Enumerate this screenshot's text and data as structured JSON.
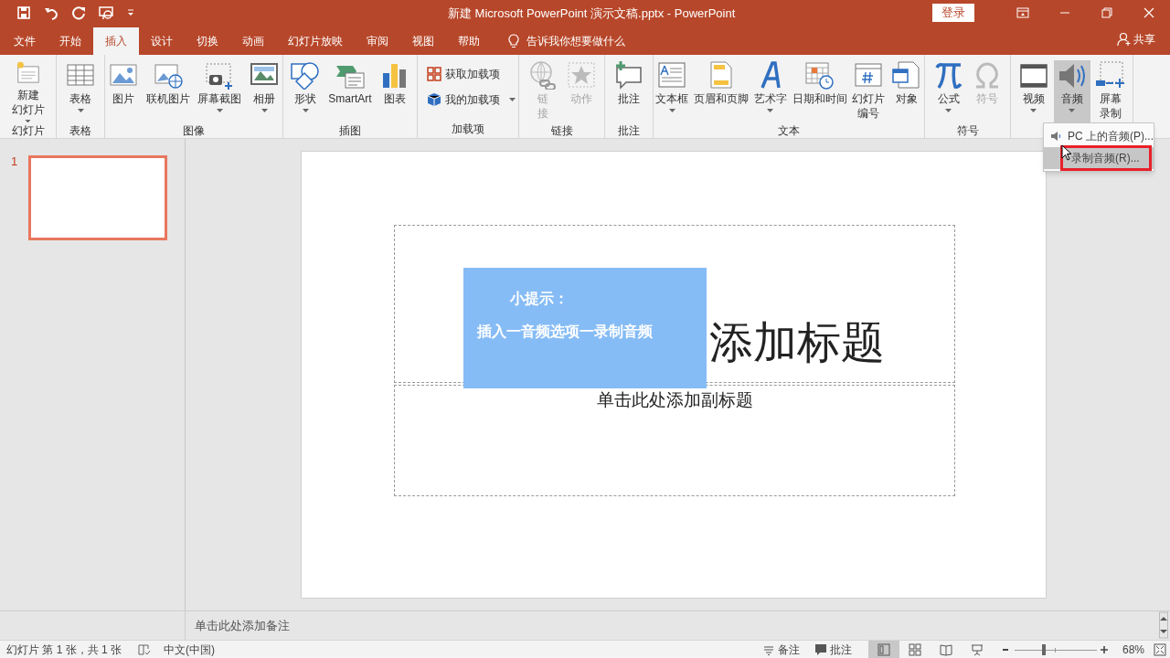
{
  "window": {
    "title": "新建 Microsoft PowerPoint 演示文稿.pptx  -  PowerPoint",
    "sign_in": "登录"
  },
  "tabs": [
    {
      "label": "文件",
      "selected": false
    },
    {
      "label": "开始",
      "selected": false
    },
    {
      "label": "插入",
      "selected": true
    },
    {
      "label": "设计",
      "selected": false
    },
    {
      "label": "切换",
      "selected": false
    },
    {
      "label": "动画",
      "selected": false
    },
    {
      "label": "幻灯片放映",
      "selected": false
    },
    {
      "label": "审阅",
      "selected": false
    },
    {
      "label": "视图",
      "selected": false
    },
    {
      "label": "帮助",
      "selected": false
    }
  ],
  "tell_me": "告诉我你想要做什么",
  "share": "共享",
  "ribbon": [
    {
      "label": "幻灯片",
      "buttons": [
        {
          "kind": "large",
          "lines": [
            "新建",
            "幻灯片"
          ],
          "dropdown": true,
          "disabled": false,
          "selected": false
        }
      ]
    },
    {
      "label": "表格",
      "buttons": [
        {
          "kind": "large",
          "lines": [
            "表格"
          ],
          "dropdown": true,
          "disabled": false,
          "selected": false
        }
      ]
    },
    {
      "label": "图像",
      "buttons": [
        {
          "kind": "large",
          "lines": [
            "图片"
          ],
          "dropdown": false,
          "disabled": false,
          "selected": false
        },
        {
          "kind": "large",
          "lines": [
            "联机图片"
          ],
          "dropdown": false,
          "disabled": false,
          "selected": false
        },
        {
          "kind": "large",
          "lines": [
            "屏幕截图"
          ],
          "dropdown": true,
          "disabled": false,
          "selected": false
        },
        {
          "kind": "large",
          "lines": [
            "相册"
          ],
          "dropdown": true,
          "disabled": false,
          "selected": false
        }
      ]
    },
    {
      "label": "插图",
      "buttons": [
        {
          "kind": "large",
          "lines": [
            "形状"
          ],
          "dropdown": true,
          "disabled": false,
          "selected": false
        },
        {
          "kind": "large",
          "lines": [
            "SmartArt"
          ],
          "dropdown": false,
          "disabled": false,
          "selected": false
        },
        {
          "kind": "large",
          "lines": [
            "图表"
          ],
          "dropdown": false,
          "disabled": false,
          "selected": false
        }
      ]
    },
    {
      "label": "加载项",
      "buttons": [
        {
          "kind": "small",
          "lines": [
            "获取加载项"
          ],
          "dropdown": false,
          "disabled": false,
          "selected": false
        },
        {
          "kind": "small",
          "lines": [
            "我的加载项"
          ],
          "dropdown": true,
          "disabled": false,
          "selected": false
        }
      ]
    },
    {
      "label": "链接",
      "buttons": [
        {
          "kind": "large",
          "lines": [
            "链",
            "接"
          ],
          "dropdown": false,
          "disabled": true,
          "selected": false
        },
        {
          "kind": "large",
          "lines": [
            "动作"
          ],
          "dropdown": false,
          "disabled": true,
          "selected": false
        }
      ]
    },
    {
      "label": "批注",
      "buttons": [
        {
          "kind": "large",
          "lines": [
            "批注"
          ],
          "dropdown": false,
          "disabled": false,
          "selected": false
        }
      ]
    },
    {
      "label": "文本",
      "buttons": [
        {
          "kind": "large",
          "lines": [
            "文本框"
          ],
          "dropdown": true,
          "disabled": false,
          "selected": false
        },
        {
          "kind": "large",
          "lines": [
            "页眉和页脚"
          ],
          "dropdown": false,
          "disabled": false,
          "selected": false
        },
        {
          "kind": "large",
          "lines": [
            "艺术字"
          ],
          "dropdown": true,
          "disabled": false,
          "selected": false
        },
        {
          "kind": "large",
          "lines": [
            "日期和时间"
          ],
          "dropdown": false,
          "disabled": false,
          "selected": false
        },
        {
          "kind": "large",
          "lines": [
            "幻灯片",
            "编号"
          ],
          "dropdown": false,
          "disabled": false,
          "selected": false
        },
        {
          "kind": "large",
          "lines": [
            "对象"
          ],
          "dropdown": false,
          "disabled": false,
          "selected": false
        }
      ]
    },
    {
      "label": "符号",
      "buttons": [
        {
          "kind": "large",
          "lines": [
            "公式"
          ],
          "dropdown": true,
          "disabled": false,
          "selected": false
        },
        {
          "kind": "large",
          "lines": [
            "符号"
          ],
          "dropdown": false,
          "disabled": true,
          "selected": false
        }
      ]
    },
    {
      "buttons": [
        {
          "kind": "large",
          "lines": [
            "视频"
          ],
          "dropdown": true,
          "disabled": false,
          "selected": false
        },
        {
          "kind": "large",
          "lines": [
            "音频"
          ],
          "dropdown": true,
          "disabled": false,
          "selected": true
        },
        {
          "kind": "large",
          "lines": [
            "屏幕",
            "录制"
          ],
          "dropdown": false,
          "disabled": false,
          "selected": false
        }
      ]
    }
  ],
  "audio_menu": [
    {
      "label": "PC 上的音频(P)...",
      "selected": false,
      "highlighted_box": false
    },
    {
      "label": "录制音频(R)...",
      "selected": true,
      "highlighted_box": true
    }
  ],
  "slides": [
    {
      "number": "1",
      "selected": true
    }
  ],
  "slide": {
    "title": "添加标题",
    "subtitle": "单击此处添加副标题"
  },
  "tip": {
    "heading": "小提示：",
    "text": "插入一音频选项一录制音频"
  },
  "notes_placeholder": "单击此处添加备注",
  "status_bar": {
    "slide_info": "幻灯片 第 1 张，共 1 张",
    "language": "中文(中国)",
    "notes": "备注",
    "comments": "批注",
    "views": [
      {
        "selected": true
      },
      {
        "selected": false
      },
      {
        "selected": false
      },
      {
        "selected": false
      }
    ],
    "zoom": {
      "level": 0.35,
      "reading": "68%"
    }
  }
}
